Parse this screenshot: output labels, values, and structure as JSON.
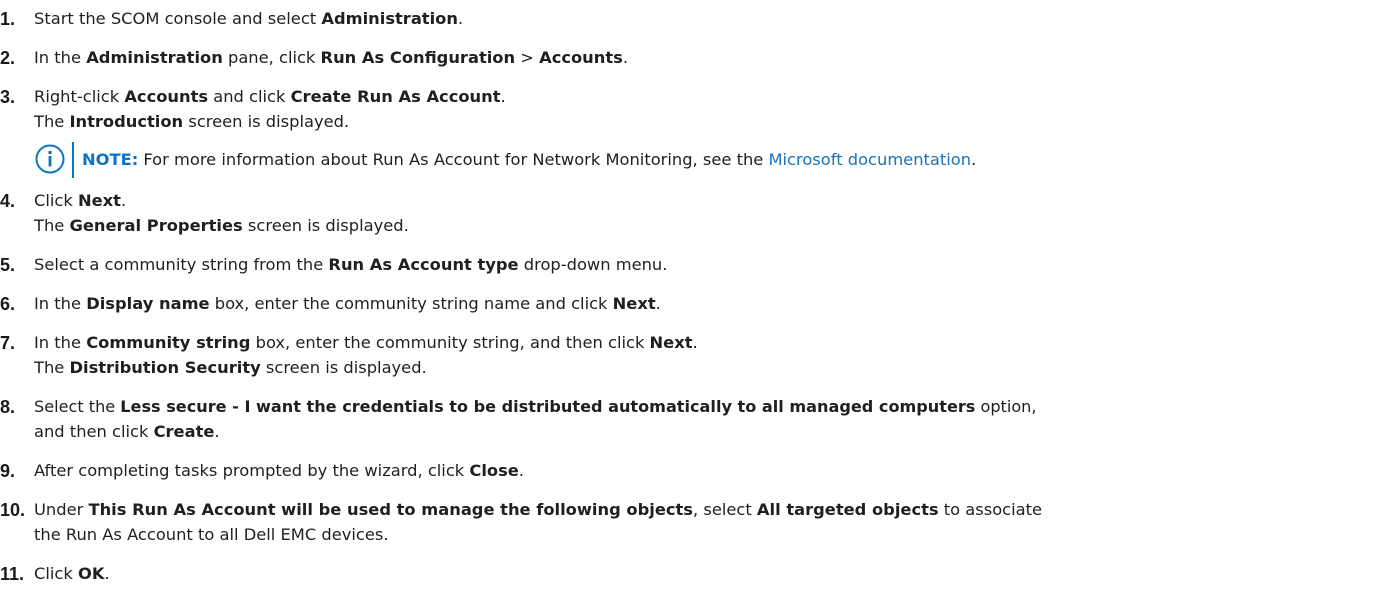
{
  "steps": [
    {
      "num": "1.",
      "l1": [
        "Start the SCOM console and select ",
        "Administration",
        "."
      ]
    },
    {
      "num": "2.",
      "l1": [
        "In the ",
        "Administration",
        " pane, click ",
        "Run As Configuration",
        " > ",
        "Accounts",
        "."
      ]
    },
    {
      "num": "3.",
      "l1": [
        "Right-click ",
        "Accounts",
        " and click ",
        "Create Run As Account",
        "."
      ],
      "l2": [
        "The ",
        "Introduction",
        " screen is displayed."
      ]
    },
    {
      "num": "4.",
      "l1": [
        "Click ",
        "Next",
        "."
      ],
      "l2": [
        "The ",
        "General Properties",
        " screen is displayed."
      ]
    },
    {
      "num": "5.",
      "l1": [
        "Select a community string from the ",
        "Run As Account type",
        " drop-down menu."
      ]
    },
    {
      "num": "6.",
      "l1": [
        "In the ",
        "Display name",
        " box, enter the community string name and click ",
        "Next",
        "."
      ]
    },
    {
      "num": "7.",
      "l1": [
        "In the ",
        "Community string",
        " box, enter the community string, and then click ",
        "Next",
        "."
      ],
      "l2": [
        "The ",
        "Distribution Security",
        " screen is displayed."
      ]
    },
    {
      "num": "8.",
      "l1": [
        "Select the ",
        "Less secure - I want the credentials to be distributed automatically to all managed computers",
        " option,"
      ],
      "l2": [
        "and then click ",
        "Create",
        "."
      ]
    },
    {
      "num": "9.",
      "l1": [
        "After completing tasks prompted by the wizard, click ",
        "Close",
        "."
      ]
    },
    {
      "num": "10.",
      "l1": [
        "Under ",
        "This Run As Account will be used to manage the following objects",
        ", select ",
        "All targeted objects",
        " to associate"
      ],
      "l2": [
        "the Run As Account to all Dell EMC devices."
      ]
    },
    {
      "num": "11.",
      "l1": [
        "Click ",
        "OK",
        "."
      ]
    }
  ],
  "note": {
    "label": "NOTE:",
    "text": " For more information about Run As Account for Network Monitoring, see the ",
    "link": "Microsoft documentation",
    "end": "."
  },
  "colors": {
    "accent": "#0b74c4",
    "link": "#1a73b8",
    "text": "#1f1f1f"
  }
}
